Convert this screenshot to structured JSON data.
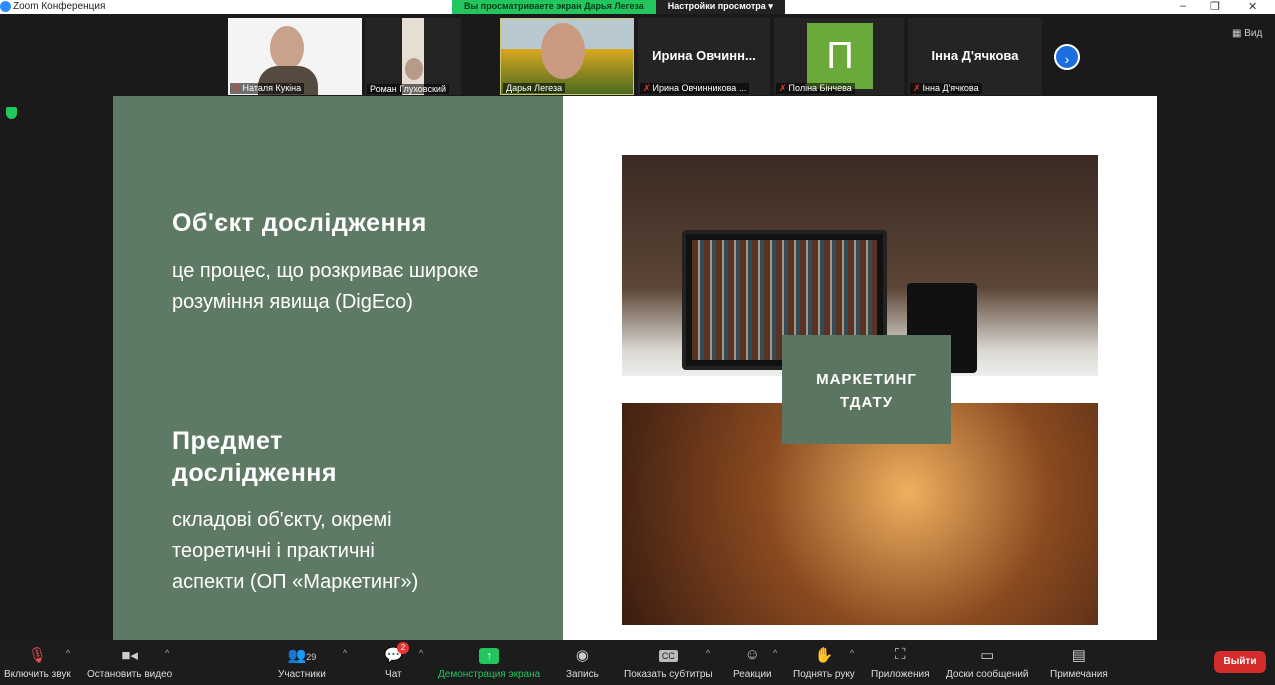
{
  "window": {
    "title": "Zoom Конференция",
    "minimize": "–",
    "restore": "❐",
    "close": "✕"
  },
  "share_banner": {
    "text": "Вы просматриваете экран Дарья Легеза",
    "options": "Настройки просмотра",
    "chevron": "▾"
  },
  "view_button": "Вид",
  "participants": [
    {
      "name": "Наталя Кукіна",
      "muted": true
    },
    {
      "name": "Роман Глуховский",
      "muted": false
    },
    {
      "name": "Дарья Легеза",
      "muted": false
    },
    {
      "name": "Ирина Овчинникова ...",
      "display": "Ирина  Овчинн...",
      "muted": true
    },
    {
      "name": "Поліна Бінчева",
      "initial": "П",
      "muted": true
    },
    {
      "name": "Інна Д'ячкова",
      "display": "Інна Д'ячкова",
      "muted": true
    }
  ],
  "slide": {
    "heading1": "Об'єкт дослідження",
    "text1_line1": "це процес, що розкриває широке",
    "text1_line2": "розуміння явища (DigEco)",
    "heading2_line1": "Предмет",
    "heading2_line2": "дослідження",
    "text2_line1": "складові об'єкту, окремі",
    "text2_line2": "теоретичні і практичні",
    "text2_line3": "аспекти (ОП «Маркетинг»)",
    "badge_line1": "МАРКЕТИНГ",
    "badge_line2": "ТДАТУ"
  },
  "toolbar": {
    "unmute": "Включить звук",
    "stop_video": "Остановить видео",
    "participants": "Участники",
    "participants_count": "29",
    "chat": "Чат",
    "chat_badge": "2",
    "share": "Демонстрация экрана",
    "record": "Запись",
    "captions": "Показать субтитры",
    "reactions": "Реакции",
    "raise_hand": "Поднять руку",
    "apps": "Приложения",
    "whiteboards": "Доски сообщений",
    "notes": "Примечания",
    "leave": "Выйти"
  },
  "colors": {
    "slide_green": "#5f7a64",
    "share_green": "#22c55e",
    "leave_red": "#d42b2b"
  }
}
